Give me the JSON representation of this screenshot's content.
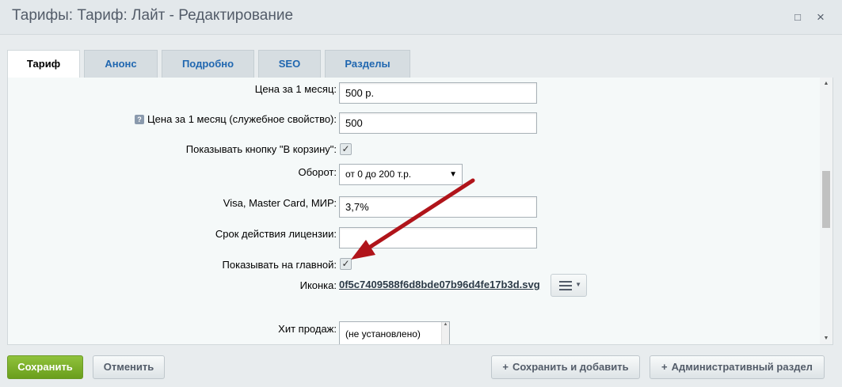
{
  "window": {
    "title": "Тарифы: Тариф: Лайт - Редактирование",
    "maximize_icon": "□",
    "close_icon": "×"
  },
  "tabs": [
    {
      "label": "Тариф",
      "active": true
    },
    {
      "label": "Анонс",
      "active": false
    },
    {
      "label": "Подробно",
      "active": false
    },
    {
      "label": "SEO",
      "active": false
    },
    {
      "label": "Разделы",
      "active": false
    }
  ],
  "form": {
    "price_label": "Цена за 1 месяц:",
    "price_value": "500 р.",
    "price_service_label": "Цена за 1 месяц (служебное свойство):",
    "price_service_value": "500",
    "cart_button_label": "Показывать кнопку \"В корзину\":",
    "cart_button_checked": true,
    "turnover_label": "Оборот:",
    "turnover_value": "от 0 до 200 т.р.",
    "cards_label": "Visa, Master Card, МИР:",
    "cards_value": "3,7%",
    "license_label": "Срок действия лицензии:",
    "license_value": "",
    "show_main_label": "Показывать на главной:",
    "show_main_checked": true,
    "icon_label": "Иконка:",
    "icon_file": "0f5c7409588f6d8bde07b96d4fe17b3d.svg",
    "hit_label": "Хит продаж:",
    "hit_value": "(не установлено)"
  },
  "footer": {
    "save": "Сохранить",
    "cancel": "Отменить",
    "save_add": "Сохранить и добавить",
    "admin_section": "Административный раздел"
  },
  "colors": {
    "annotation_arrow": "#b0141a",
    "save_button": "#7bb02b",
    "tab_link": "#2067b0"
  }
}
